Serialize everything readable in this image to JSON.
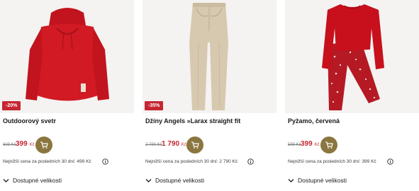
{
  "products": [
    {
      "badge": "-20%",
      "title": "Outdoorový svetr",
      "old_price": "609 Kč",
      "new_price": "399",
      "currency": "Kč",
      "lowest_price_text": "Nejnižší cena za posledních 30 dní: 499 Kč",
      "sizes_label": "Dostupné velikosti",
      "image_icon": "red-hoodie-image"
    },
    {
      "badge": "-35%",
      "title": "Džíny Angels »Larax straight fit",
      "old_price": "2 790 Kč",
      "new_price": "1 790",
      "currency": "Kč",
      "lowest_price_text": "Nejnižší cena za posledních 30 dní: 2 790 Kč",
      "sizes_label": "Dostupné velikosti",
      "image_icon": "beige-jeans-image"
    },
    {
      "badge": "",
      "title": "Pyžamo, červená",
      "old_price": "599 Kč",
      "new_price": "399",
      "currency": "Kč",
      "lowest_price_text": "Nejnižší cena za posledních 30 dní: 399 Kč",
      "sizes_label": "Dostupné velikosti",
      "image_icon": "red-pajamas-image"
    }
  ],
  "colors": {
    "accent_red": "#c62632",
    "cart_gold": "#8b7640",
    "image_bg": "#f4f3f1"
  }
}
